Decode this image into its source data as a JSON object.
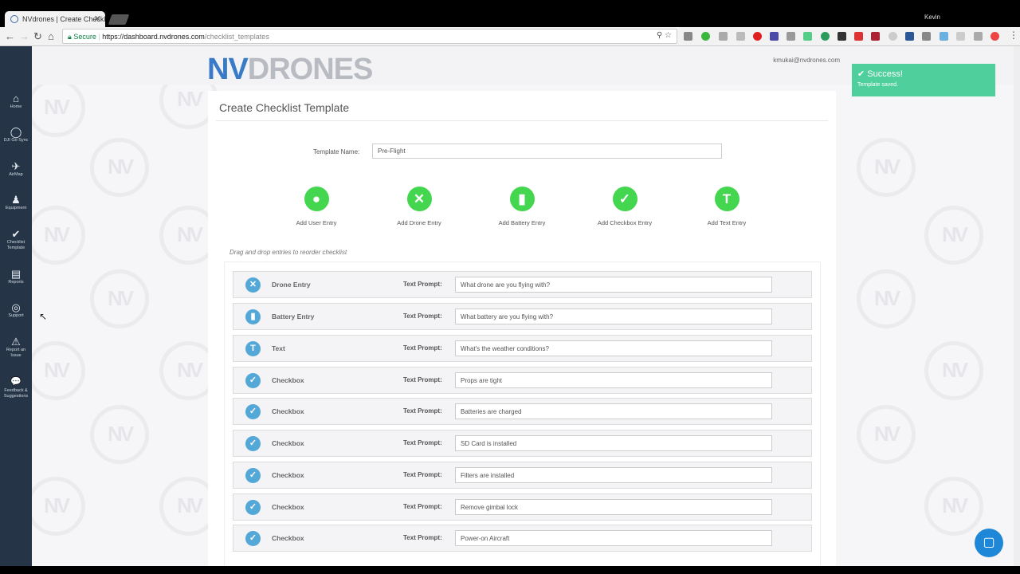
{
  "browser": {
    "tab_title": "NVdrones | Create Checkl",
    "user": "Kevin",
    "secure_label": "Secure",
    "url_origin": "https://dashboard.nvdrones.com",
    "url_path": "/checklist_templates"
  },
  "sidebar": {
    "items": [
      {
        "icon": "⌂",
        "label": "Home"
      },
      {
        "icon": "◯",
        "label": "DJI Go Sync"
      },
      {
        "icon": "✈",
        "label": "AirMap"
      },
      {
        "icon": "♟",
        "label": "Equipment"
      },
      {
        "icon": "✔",
        "label": "Checklist Template"
      },
      {
        "icon": "▤",
        "label": "Reports"
      },
      {
        "icon": "◎",
        "label": "Support"
      },
      {
        "icon": "⚠",
        "label": "Report an Issue"
      },
      {
        "icon": "💬",
        "label": "Feedback & Suggestions"
      }
    ]
  },
  "header": {
    "logo_left": "NV",
    "logo_right": "DRONES",
    "user_email": "kmukai@nvdrones.com"
  },
  "toast": {
    "title": "Success!",
    "body": "Template saved.",
    "color": "#4fcf9b"
  },
  "form": {
    "page_title": "Create Checklist Template",
    "template_name_label": "Template Name:",
    "template_name_value": "Pre-Flight",
    "hint": "Drag and drop entries to reorder checklist"
  },
  "adders": [
    {
      "icon": "user-icon",
      "glyph": "●",
      "label": "Add User Entry"
    },
    {
      "icon": "drone-x-icon",
      "glyph": "✕",
      "label": "Add Drone Entry"
    },
    {
      "icon": "battery-icon",
      "glyph": "▮",
      "label": "Add Battery Entry"
    },
    {
      "icon": "checkmark-icon",
      "glyph": "✓",
      "label": "Add Checkbox Entry"
    },
    {
      "icon": "text-t-icon",
      "glyph": "T",
      "label": "Add Text Entry"
    }
  ],
  "entries": [
    {
      "type": "Drone Entry",
      "glyph": "✕",
      "prompt_label": "Text Prompt:",
      "prompt": "What drone are you flying with?"
    },
    {
      "type": "Battery Entry",
      "glyph": "▮",
      "prompt_label": "Text Prompt:",
      "prompt": "What battery are you flying with?"
    },
    {
      "type": "Text",
      "glyph": "T",
      "prompt_label": "Text Prompt:",
      "prompt": "What's the weather conditions?"
    },
    {
      "type": "Checkbox",
      "glyph": "✓",
      "prompt_label": "Text Prompt:",
      "prompt": "Props are tight"
    },
    {
      "type": "Checkbox",
      "glyph": "✓",
      "prompt_label": "Text Prompt:",
      "prompt": "Batteries are charged"
    },
    {
      "type": "Checkbox",
      "glyph": "✓",
      "prompt_label": "Text Prompt:",
      "prompt": "SD Card is installed"
    },
    {
      "type": "Checkbox",
      "glyph": "✓",
      "prompt_label": "Text Prompt:",
      "prompt": "Filters are installed"
    },
    {
      "type": "Checkbox",
      "glyph": "✓",
      "prompt_label": "Text Prompt:",
      "prompt": "Remove gimbal lock"
    },
    {
      "type": "Checkbox",
      "glyph": "✓",
      "prompt_label": "Text Prompt:",
      "prompt": "Power-on Aircraft"
    }
  ],
  "colors": {
    "accent_green": "#44d64e",
    "entry_icon_blue": "#53a8d8",
    "sidebar_bg": "#253447"
  }
}
